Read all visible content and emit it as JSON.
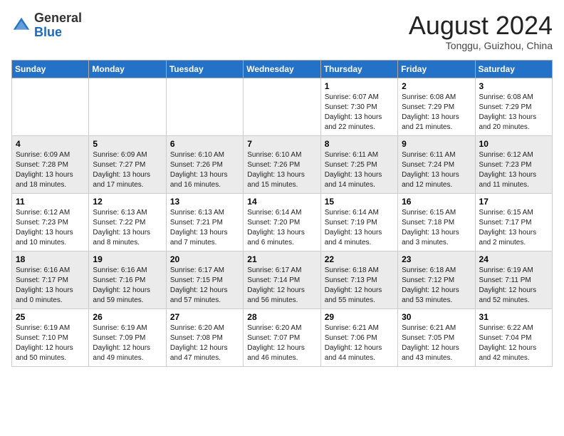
{
  "header": {
    "logo_general": "General",
    "logo_blue": "Blue",
    "month_year": "August 2024",
    "location": "Tonggu, Guizhou, China"
  },
  "weekdays": [
    "Sunday",
    "Monday",
    "Tuesday",
    "Wednesday",
    "Thursday",
    "Friday",
    "Saturday"
  ],
  "weeks": [
    [
      {
        "day": "",
        "info": ""
      },
      {
        "day": "",
        "info": ""
      },
      {
        "day": "",
        "info": ""
      },
      {
        "day": "",
        "info": ""
      },
      {
        "day": "1",
        "info": "Sunrise: 6:07 AM\nSunset: 7:30 PM\nDaylight: 13 hours\nand 22 minutes."
      },
      {
        "day": "2",
        "info": "Sunrise: 6:08 AM\nSunset: 7:29 PM\nDaylight: 13 hours\nand 21 minutes."
      },
      {
        "day": "3",
        "info": "Sunrise: 6:08 AM\nSunset: 7:29 PM\nDaylight: 13 hours\nand 20 minutes."
      }
    ],
    [
      {
        "day": "4",
        "info": "Sunrise: 6:09 AM\nSunset: 7:28 PM\nDaylight: 13 hours\nand 18 minutes."
      },
      {
        "day": "5",
        "info": "Sunrise: 6:09 AM\nSunset: 7:27 PM\nDaylight: 13 hours\nand 17 minutes."
      },
      {
        "day": "6",
        "info": "Sunrise: 6:10 AM\nSunset: 7:26 PM\nDaylight: 13 hours\nand 16 minutes."
      },
      {
        "day": "7",
        "info": "Sunrise: 6:10 AM\nSunset: 7:26 PM\nDaylight: 13 hours\nand 15 minutes."
      },
      {
        "day": "8",
        "info": "Sunrise: 6:11 AM\nSunset: 7:25 PM\nDaylight: 13 hours\nand 14 minutes."
      },
      {
        "day": "9",
        "info": "Sunrise: 6:11 AM\nSunset: 7:24 PM\nDaylight: 13 hours\nand 12 minutes."
      },
      {
        "day": "10",
        "info": "Sunrise: 6:12 AM\nSunset: 7:23 PM\nDaylight: 13 hours\nand 11 minutes."
      }
    ],
    [
      {
        "day": "11",
        "info": "Sunrise: 6:12 AM\nSunset: 7:23 PM\nDaylight: 13 hours\nand 10 minutes."
      },
      {
        "day": "12",
        "info": "Sunrise: 6:13 AM\nSunset: 7:22 PM\nDaylight: 13 hours\nand 8 minutes."
      },
      {
        "day": "13",
        "info": "Sunrise: 6:13 AM\nSunset: 7:21 PM\nDaylight: 13 hours\nand 7 minutes."
      },
      {
        "day": "14",
        "info": "Sunrise: 6:14 AM\nSunset: 7:20 PM\nDaylight: 13 hours\nand 6 minutes."
      },
      {
        "day": "15",
        "info": "Sunrise: 6:14 AM\nSunset: 7:19 PM\nDaylight: 13 hours\nand 4 minutes."
      },
      {
        "day": "16",
        "info": "Sunrise: 6:15 AM\nSunset: 7:18 PM\nDaylight: 13 hours\nand 3 minutes."
      },
      {
        "day": "17",
        "info": "Sunrise: 6:15 AM\nSunset: 7:17 PM\nDaylight: 13 hours\nand 2 minutes."
      }
    ],
    [
      {
        "day": "18",
        "info": "Sunrise: 6:16 AM\nSunset: 7:17 PM\nDaylight: 13 hours\nand 0 minutes."
      },
      {
        "day": "19",
        "info": "Sunrise: 6:16 AM\nSunset: 7:16 PM\nDaylight: 12 hours\nand 59 minutes."
      },
      {
        "day": "20",
        "info": "Sunrise: 6:17 AM\nSunset: 7:15 PM\nDaylight: 12 hours\nand 57 minutes."
      },
      {
        "day": "21",
        "info": "Sunrise: 6:17 AM\nSunset: 7:14 PM\nDaylight: 12 hours\nand 56 minutes."
      },
      {
        "day": "22",
        "info": "Sunrise: 6:18 AM\nSunset: 7:13 PM\nDaylight: 12 hours\nand 55 minutes."
      },
      {
        "day": "23",
        "info": "Sunrise: 6:18 AM\nSunset: 7:12 PM\nDaylight: 12 hours\nand 53 minutes."
      },
      {
        "day": "24",
        "info": "Sunrise: 6:19 AM\nSunset: 7:11 PM\nDaylight: 12 hours\nand 52 minutes."
      }
    ],
    [
      {
        "day": "25",
        "info": "Sunrise: 6:19 AM\nSunset: 7:10 PM\nDaylight: 12 hours\nand 50 minutes."
      },
      {
        "day": "26",
        "info": "Sunrise: 6:19 AM\nSunset: 7:09 PM\nDaylight: 12 hours\nand 49 minutes."
      },
      {
        "day": "27",
        "info": "Sunrise: 6:20 AM\nSunset: 7:08 PM\nDaylight: 12 hours\nand 47 minutes."
      },
      {
        "day": "28",
        "info": "Sunrise: 6:20 AM\nSunset: 7:07 PM\nDaylight: 12 hours\nand 46 minutes."
      },
      {
        "day": "29",
        "info": "Sunrise: 6:21 AM\nSunset: 7:06 PM\nDaylight: 12 hours\nand 44 minutes."
      },
      {
        "day": "30",
        "info": "Sunrise: 6:21 AM\nSunset: 7:05 PM\nDaylight: 12 hours\nand 43 minutes."
      },
      {
        "day": "31",
        "info": "Sunrise: 6:22 AM\nSunset: 7:04 PM\nDaylight: 12 hours\nand 42 minutes."
      }
    ]
  ]
}
